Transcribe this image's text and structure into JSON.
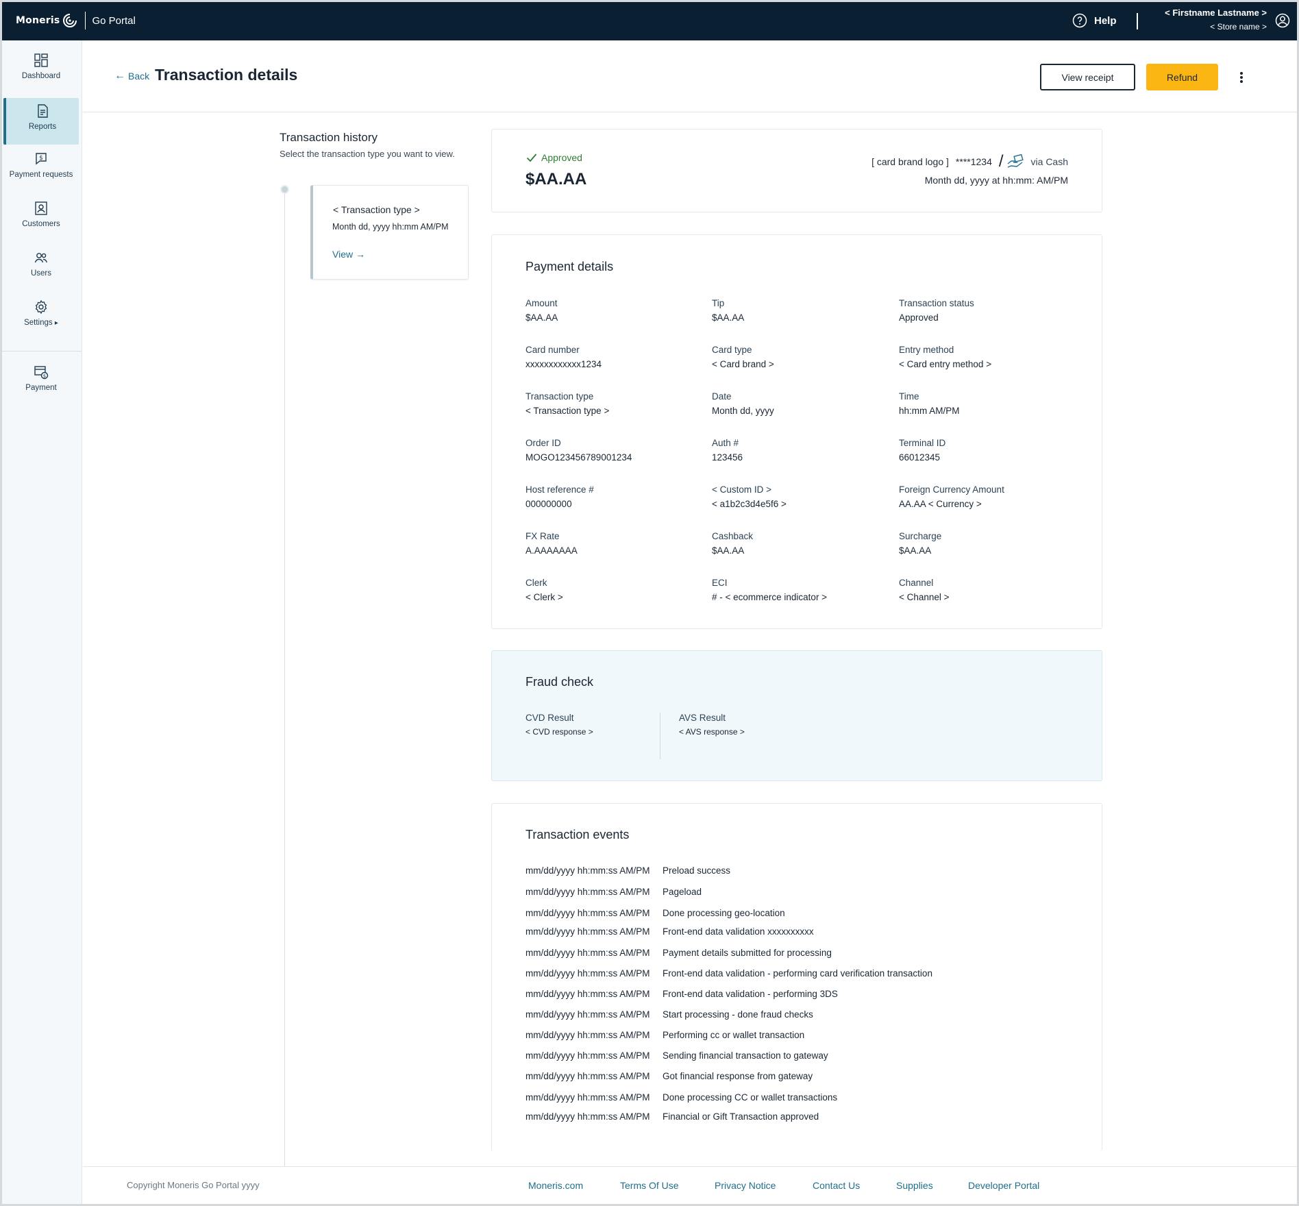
{
  "topbar": {
    "brand_name": "Moneris",
    "portal_name": "Go Portal",
    "help_label": "Help",
    "user_name": "< Firstname Lastname >",
    "store_name": "< Store name >"
  },
  "sidebar": {
    "items": [
      {
        "label": "Dashboard",
        "icon": "dashboard-icon"
      },
      {
        "label": "Reports",
        "icon": "reports-icon",
        "active": true
      },
      {
        "label": "Payment requests",
        "icon": "payment-requests-icon"
      },
      {
        "label": "Customers",
        "icon": "customers-icon"
      },
      {
        "label": "Users",
        "icon": "users-icon"
      },
      {
        "label": "Settings",
        "icon": "settings-icon"
      },
      {
        "label": "Payment",
        "icon": "payment-icon"
      }
    ]
  },
  "header": {
    "back_label": "Back",
    "title": "Transaction details",
    "view_receipt_label": "View receipt",
    "refund_label": "Refund"
  },
  "history": {
    "title": "Transaction history",
    "subtitle": "Select the transaction type you want to view.",
    "card": {
      "type": "< Transaction type >",
      "date": "Month dd, yyyy hh:mm AM/PM",
      "view_label": "View"
    }
  },
  "summary": {
    "status": "Approved",
    "amount": "$AA.AA",
    "card_logo": "[ card brand logo ]",
    "masked_card": "****1234",
    "via": "via Cash",
    "datetime": "Month dd, yyyy at hh:mm: AM/PM"
  },
  "payment_details": {
    "title": "Payment details",
    "fields": [
      {
        "label": "Amount",
        "value": "$AA.AA"
      },
      {
        "label": "Tip",
        "value": "$AA.AA"
      },
      {
        "label": "Transaction status",
        "value": "Approved"
      },
      {
        "label": "Card number",
        "value": "xxxxxxxxxxxx1234"
      },
      {
        "label": "Card type",
        "value": "< Card brand >"
      },
      {
        "label": "Entry method",
        "value": "< Card entry method >"
      },
      {
        "label": "Transaction type",
        "value": "< Transaction type >"
      },
      {
        "label": "Date",
        "value": "Month dd, yyyy"
      },
      {
        "label": "Time",
        "value": "hh:mm AM/PM"
      },
      {
        "label": "Order ID",
        "value": "MOGO123456789001234"
      },
      {
        "label": "Auth #",
        "value": "123456"
      },
      {
        "label": "Terminal ID",
        "value": "66012345"
      },
      {
        "label": "Host reference #",
        "value": "000000000"
      },
      {
        "label": "< Custom ID >",
        "value": "< a1b2c3d4e5f6 >"
      },
      {
        "label": "Foreign Currency Amount",
        "value": "AA.AA < Currency >"
      },
      {
        "label": "FX Rate",
        "value": "A.AAAAAAA"
      },
      {
        "label": "Cashback",
        "value": "$AA.AA"
      },
      {
        "label": "Surcharge",
        "value": "$AA.AA"
      },
      {
        "label": "Clerk",
        "value": "< Clerk >"
      },
      {
        "label": "ECI",
        "value": "# - < ecommerce indicator >"
      },
      {
        "label": "Channel",
        "value": "< Channel >"
      }
    ]
  },
  "fraud_check": {
    "title": "Fraud check",
    "cvd_label": "CVD Result",
    "cvd_value": "< CVD response >",
    "avs_label": "AVS Result",
    "avs_value": "< AVS response >"
  },
  "transaction_events": {
    "title": "Transaction events",
    "events": [
      {
        "ts": "mm/dd/yyyy hh:mm:ss AM/PM",
        "text": "Preload success"
      },
      {
        "ts": "mm/dd/yyyy hh:mm:ss AM/PM",
        "text": "Pageload"
      },
      {
        "ts": "mm/dd/yyyy hh:mm:ss AM/PM",
        "text": "Done processing geo-location"
      },
      {
        "ts": "mm/dd/yyyy hh:mm:ss AM/PM",
        "text": "Front-end data validation xxxxxxxxxx"
      },
      {
        "ts": "mm/dd/yyyy hh:mm:ss AM/PM",
        "text": "Payment details submitted for processing"
      },
      {
        "ts": "mm/dd/yyyy hh:mm:ss AM/PM",
        "text": "Front-end data validation - performing card verification transaction"
      },
      {
        "ts": "mm/dd/yyyy hh:mm:ss AM/PM",
        "text": "Front-end data validation - performing 3DS"
      },
      {
        "ts": "mm/dd/yyyy hh:mm:ss AM/PM",
        "text": "Start processing - done fraud checks"
      },
      {
        "ts": "mm/dd/yyyy hh:mm:ss AM/PM",
        "text": "Performing cc or wallet transaction"
      },
      {
        "ts": "mm/dd/yyyy hh:mm:ss AM/PM",
        "text": "Sending financial transaction to gateway"
      },
      {
        "ts": "mm/dd/yyyy hh:mm:ss AM/PM",
        "text": "Got financial response from gateway"
      },
      {
        "ts": "mm/dd/yyyy hh:mm:ss AM/PM",
        "text": "Done processing CC or wallet transactions"
      },
      {
        "ts": "mm/dd/yyyy hh:mm:ss AM/PM",
        "text": "Financial or Gift Transaction approved"
      }
    ]
  },
  "footer": {
    "copyright": "Copyright Moneris Go Portal  yyyy",
    "links": [
      "Moneris.com",
      "Terms Of Use",
      "Privacy Notice",
      "Contact Us",
      "Supplies",
      "Developer Portal"
    ]
  },
  "colors": {
    "topbar_bg": "#0b1f33",
    "accent": "#1f6f8b",
    "refund_button": "#fbb614",
    "approved": "#2e7d32",
    "fraud_bg": "#f1f8fb"
  }
}
